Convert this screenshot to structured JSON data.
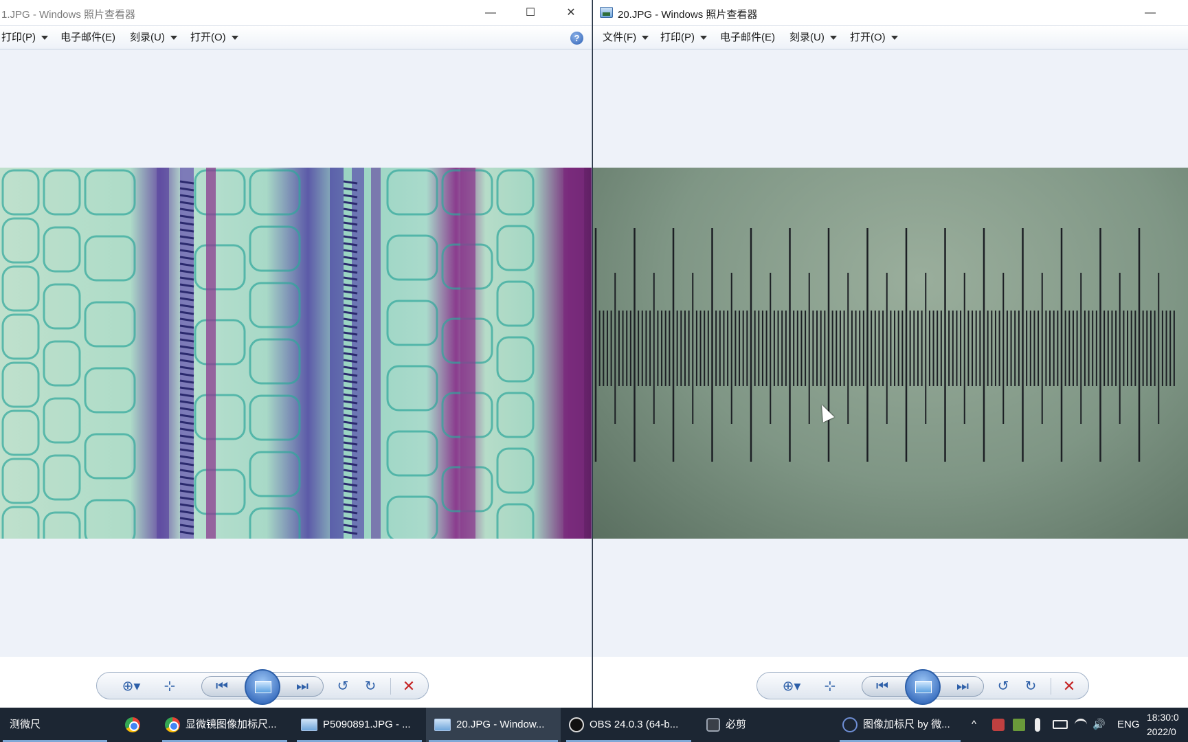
{
  "left_window": {
    "title": "1.JPG - Windows 照片查看器",
    "menu": [
      "打印(P)",
      "电子邮件(E)",
      "刻录(U)",
      "打开(O)"
    ],
    "menu_dropdown": [
      true,
      false,
      true,
      true
    ],
    "controls": {
      "minimize": "—",
      "maximize": "☐",
      "close": "✕"
    },
    "help": "?"
  },
  "right_window": {
    "title": "20.JPG - Windows 照片查看器",
    "menu": [
      "文件(F)",
      "打印(P)",
      "电子邮件(E)",
      "刻录(U)",
      "打开(O)"
    ],
    "menu_dropdown": [
      true,
      true,
      false,
      true,
      true
    ],
    "controls": {
      "minimize": "—"
    }
  },
  "toolbar_icons": {
    "zoom": "⊕▾",
    "fit": "⊹",
    "prev": "⏮",
    "next": "⏭",
    "rotate_ccw": "↺",
    "rotate_cw": "↻",
    "delete": "✕"
  },
  "taskbar": {
    "items": [
      "测微尺",
      "",
      "显微镜图像加标尺...",
      "P5090891.JPG - ...",
      "20.JPG - Window...",
      "OBS 24.0.3 (64-b...",
      "必剪",
      "图像加标尺  by 微..."
    ],
    "active_index": 4,
    "tray": {
      "input_lang": "ENG",
      "chevron": "^",
      "volume": "🔊"
    },
    "clock_time": "18:30:0",
    "clock_date": "2022/0"
  },
  "colors": {
    "stain_teal": "#a8d9c7",
    "stain_purple": "#6e5aa6",
    "stain_magenta": "#8a3c8e",
    "micrometer_bg": "#8ca090",
    "scale_tick": "#1c1f24"
  }
}
